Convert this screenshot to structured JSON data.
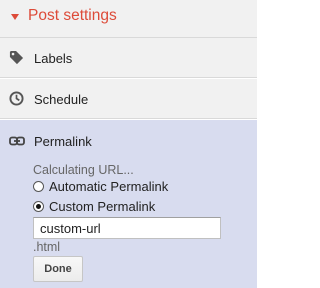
{
  "header": {
    "title": "Post settings",
    "caret_color": "#dd4b39"
  },
  "items": [
    {
      "label": "Labels",
      "icon": "tag-icon"
    },
    {
      "label": "Schedule",
      "icon": "clock-icon"
    },
    {
      "label": "Permalink",
      "icon": "link-icon"
    }
  ],
  "permalink": {
    "status": "Calculating URL...",
    "options": [
      {
        "label": "Automatic Permalink",
        "selected": false
      },
      {
        "label": "Custom Permalink",
        "selected": true
      }
    ],
    "input_value": "custom-url",
    "suffix": ".html",
    "done_label": "Done"
  },
  "colors": {
    "accent": "#dd4b39",
    "panel_bg": "#f1f1f1",
    "active_bg": "#d8dcef"
  }
}
